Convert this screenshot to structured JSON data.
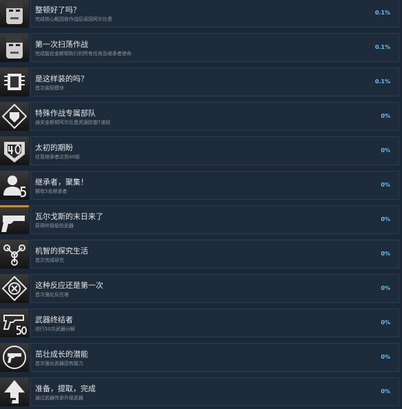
{
  "achievements": [
    {
      "title": "整顿好了吗？",
      "description": "完成核心舰回收作战后返回阿尔比恩",
      "percent": "0.1%",
      "icon": "face-portrait-icon"
    },
    {
      "title": "第一次扫荡作战",
      "description": "完成能在金斯顿执行的所有任务及继承者使命",
      "percent": "0.1%",
      "icon": "face-portrait-icon"
    },
    {
      "title": "是这样装的吗？",
      "description": "首次装配模块",
      "percent": "0.1%",
      "icon": "module-chip-icon"
    },
    {
      "title": "特殊作战专属部队",
      "description": "通关金斯顿阿尔比恩资源防御7波段",
      "percent": "0%",
      "icon": "shield-emblem-icon"
    },
    {
      "title": "太初的期盼",
      "description": "任意继承者达到40级",
      "percent": "0%",
      "icon": "level-40-icon"
    },
    {
      "title": "继承者，聚集！",
      "description": "拥有5名继承者",
      "percent": "0%",
      "icon": "user-5-icon"
    },
    {
      "title": "瓦尔戈斯的末日来了",
      "description": "获得终极级别武器",
      "percent": "0%",
      "icon": "pistol-icon"
    },
    {
      "title": "机智的探究生活",
      "description": "首次完成研究",
      "percent": "0%",
      "icon": "research-nodes-icon"
    },
    {
      "title": "这种反应还是第一次",
      "description": "首次强化反应堆",
      "percent": "0%",
      "icon": "reactor-icon"
    },
    {
      "title": "武器终结者",
      "description": "进行50次武器分解",
      "percent": "0%",
      "icon": "weapon-dismantle-50-icon"
    },
    {
      "title": "茁壮成长的潜能",
      "description": "首次强化武器固有能力",
      "percent": "0%",
      "icon": "weapon-upgrade-icon"
    },
    {
      "title": "准备，提取，完成",
      "description": "通过武器传承升级武器",
      "percent": "0%",
      "icon": "upgrade-arrow-icon"
    }
  ]
}
